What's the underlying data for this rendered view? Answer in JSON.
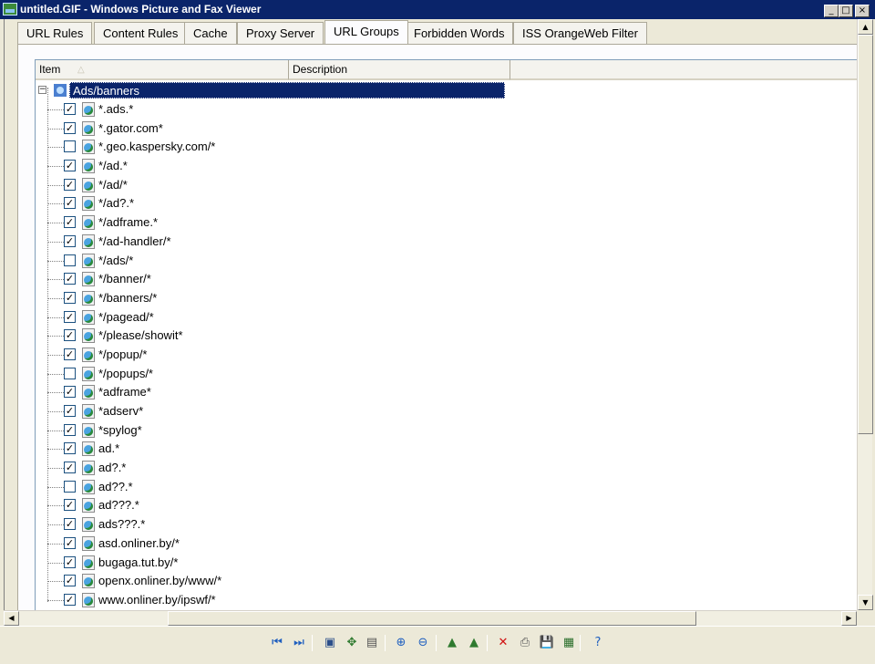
{
  "window": {
    "title": "untitled.GIF - Windows Picture and Fax Viewer",
    "controls": {
      "minimize": "_",
      "maximize": "□",
      "close": "×"
    }
  },
  "tabs": [
    {
      "label": "URL Rules",
      "active": false
    },
    {
      "label": "Content Rules",
      "active": false
    },
    {
      "label": "Cache",
      "active": false
    },
    {
      "label": "Proxy Server",
      "active": false
    },
    {
      "label": "URL Groups",
      "active": true
    },
    {
      "label": "Forbidden Words",
      "active": false
    },
    {
      "label": "ISS OrangeWeb Filter",
      "active": false
    }
  ],
  "list": {
    "columns": {
      "item": "Item",
      "description": "Description"
    },
    "sort_indicator": "△",
    "root": {
      "label": "Ads/banners",
      "expander": "−"
    },
    "items": [
      {
        "label": "*.ads.*",
        "checked": true
      },
      {
        "label": "*.gator.com*",
        "checked": true
      },
      {
        "label": "*.geo.kaspersky.com/*",
        "checked": false
      },
      {
        "label": "*/ad.*",
        "checked": true
      },
      {
        "label": "*/ad/*",
        "checked": true
      },
      {
        "label": "*/ad?.*",
        "checked": true
      },
      {
        "label": "*/adframe.*",
        "checked": true
      },
      {
        "label": "*/ad-handler/*",
        "checked": true
      },
      {
        "label": "*/ads/*",
        "checked": false
      },
      {
        "label": "*/banner/*",
        "checked": true
      },
      {
        "label": "*/banners/*",
        "checked": true
      },
      {
        "label": "*/pagead/*",
        "checked": true
      },
      {
        "label": "*/please/showit*",
        "checked": true
      },
      {
        "label": "*/popup/*",
        "checked": true
      },
      {
        "label": "*/popups/*",
        "checked": false
      },
      {
        "label": "*adframe*",
        "checked": true
      },
      {
        "label": "*adserv*",
        "checked": true
      },
      {
        "label": "*spylog*",
        "checked": true
      },
      {
        "label": "ad.*",
        "checked": true
      },
      {
        "label": "ad?.*",
        "checked": true
      },
      {
        "label": "ad??.*",
        "checked": false
      },
      {
        "label": "ad???.*",
        "checked": true
      },
      {
        "label": "ads???.*",
        "checked": true
      },
      {
        "label": "asd.onliner.by/*",
        "checked": true
      },
      {
        "label": "bugaga.tut.by/*",
        "checked": true
      },
      {
        "label": "openx.onliner.by/www/*",
        "checked": true
      },
      {
        "label": "www.onliner.by/ipswf/*",
        "checked": true
      }
    ]
  },
  "scrollbars": {
    "up": "▲",
    "down": "▼",
    "left": "◀",
    "right": "▶"
  },
  "toolbar": {
    "icons": [
      {
        "name": "previous-image-icon",
        "glyph": "⏮",
        "color": "#1f5fbf"
      },
      {
        "name": "next-image-icon",
        "glyph": "⏭",
        "color": "#1f5fbf"
      },
      {
        "name": "best-fit-icon",
        "glyph": "▣",
        "color": "#2c4f8a"
      },
      {
        "name": "actual-size-icon",
        "glyph": "✥",
        "color": "#2f7a2f"
      },
      {
        "name": "slideshow-icon",
        "glyph": "▤",
        "color": "#555555"
      },
      {
        "name": "zoom-in-icon",
        "glyph": "⊕",
        "color": "#1f5fbf"
      },
      {
        "name": "zoom-out-icon",
        "glyph": "⊖",
        "color": "#1f5fbf"
      },
      {
        "name": "rotate-clockwise-icon",
        "glyph": "▲",
        "color": "#2f7a2f"
      },
      {
        "name": "rotate-counterclockwise-icon",
        "glyph": "▲",
        "color": "#2f7a2f"
      },
      {
        "name": "delete-icon",
        "glyph": "✕",
        "color": "#d01010"
      },
      {
        "name": "print-icon",
        "glyph": "⎙",
        "color": "#555555"
      },
      {
        "name": "save-icon",
        "glyph": "💾",
        "color": "#1f3f8a"
      },
      {
        "name": "edit-icon",
        "glyph": "▦",
        "color": "#2c6f2c"
      },
      {
        "name": "help-icon",
        "glyph": "?",
        "color": "#1f5fbf"
      }
    ]
  }
}
